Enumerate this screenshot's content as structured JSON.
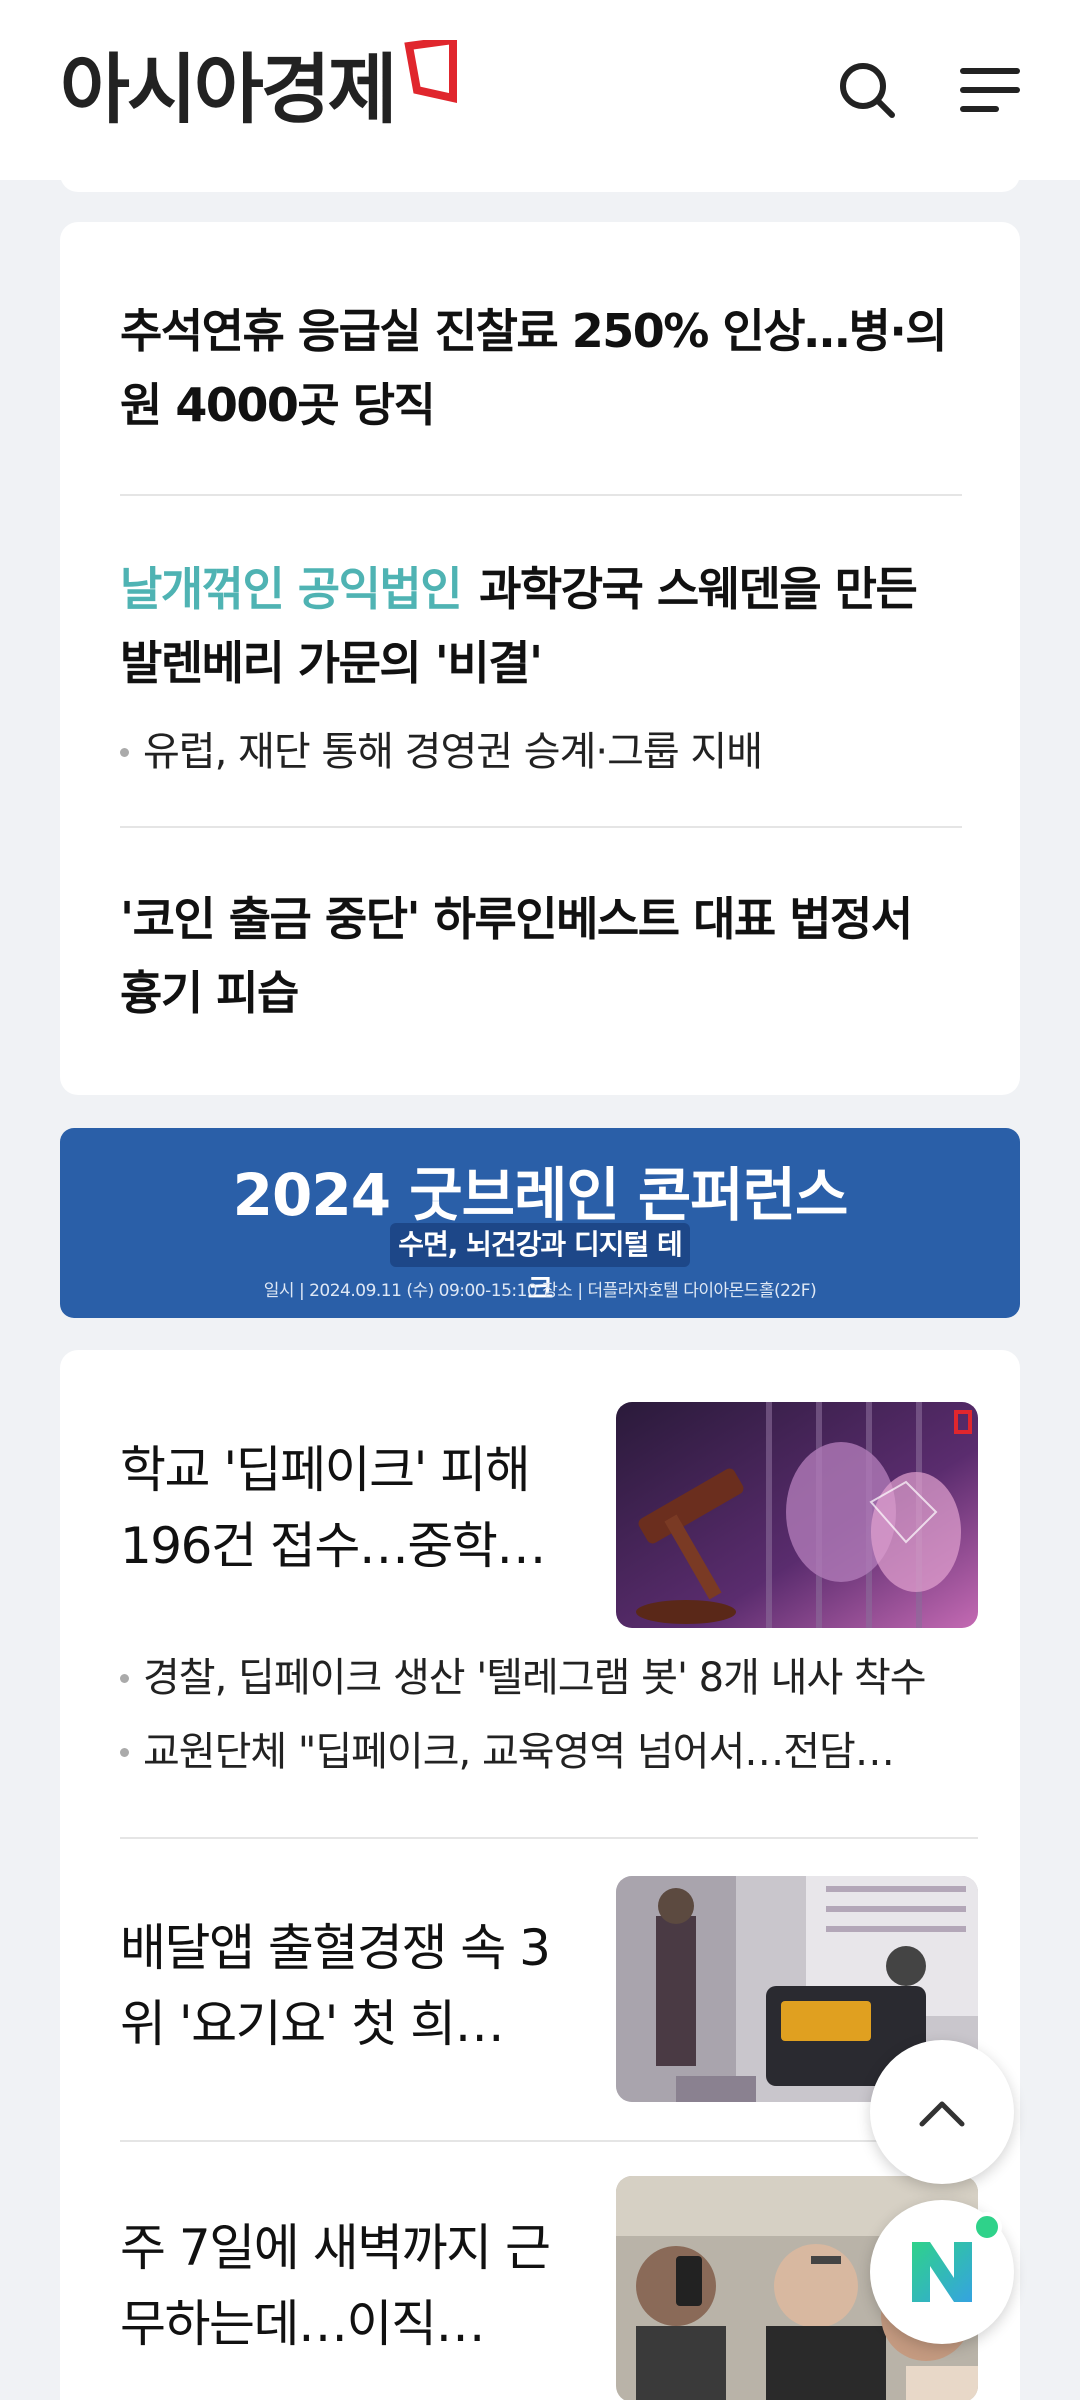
{
  "header": {
    "logo_text": "아시아경제",
    "search_icon": "search-icon",
    "menu_icon": "menu-icon"
  },
  "top_news": [
    {
      "kicker": "",
      "title": "추석연휴 응급실 진찰료 250% 인상…병·의원 4000곳 당직",
      "subs": []
    },
    {
      "kicker": "날개꺾인 공익법인",
      "title": "과학강국 스웨덴을 만든 발렌베리 가문의 '비결'",
      "subs": [
        "유럽, 재단 통해 경영권 승계·그룹 지배"
      ]
    },
    {
      "kicker": "",
      "title": "'코인 출금 중단' 하루인베스트 대표 법정서 흉기 피습",
      "subs": []
    }
  ],
  "banner": {
    "title": "2024 굿브레인 콘퍼런스",
    "subtitle": "수면, 뇌건강과 디지털 테크",
    "info": "일시 | 2024.09.11 (수) 09:00-15:10      장소 | 더플라자호텔 다이아몬드홀(22F)"
  },
  "stories": [
    {
      "title": "학교 '딥페이크' 피해 196건 접수…중학…",
      "subs": [
        "경찰, 딥페이크 생산 '텔레그램 봇' 8개 내사 착수",
        "교원단체 \"딥페이크, 교육영역 넘어서…전담…"
      ]
    },
    {
      "title": "배달앱 출혈경쟁 속 3위 '요기요' 첫 희…",
      "subs": []
    },
    {
      "title": "주 7일에 새벽까지 근무하는데…이직…",
      "subs": []
    }
  ],
  "fab": {
    "top_icon": "chevron-up-icon",
    "n_label": "N"
  },
  "colors": {
    "kicker": "#4fb3b3",
    "logo_mark": "#e0262d",
    "banner_bg": "#2a5fa8",
    "n_green": "#2fd28a"
  }
}
